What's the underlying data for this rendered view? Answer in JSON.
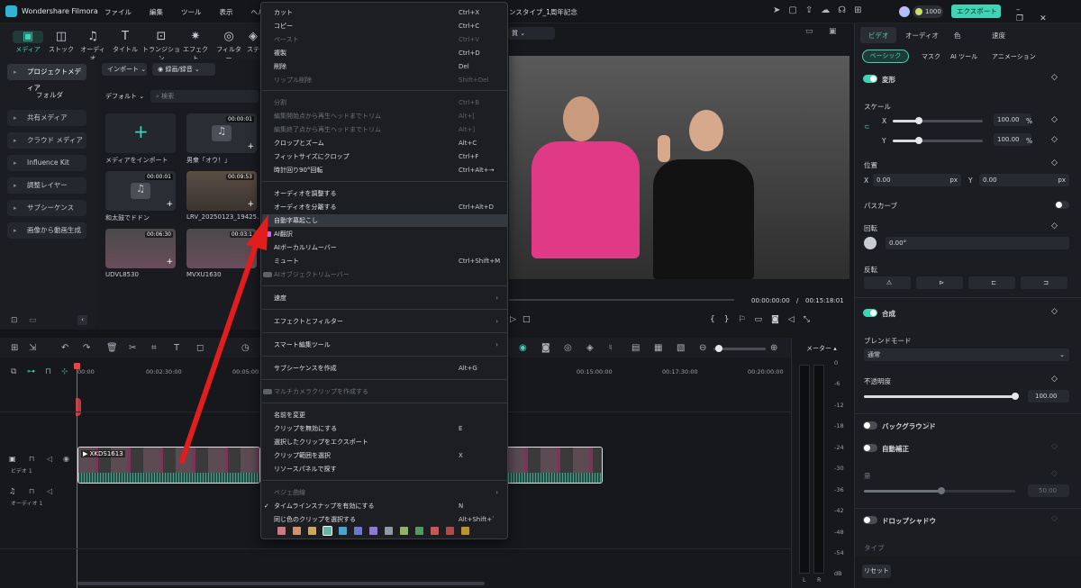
{
  "app": {
    "title": "Wondershare Filmora",
    "doc_title": "ンスタイプ_1周年記念",
    "menu": [
      "ファイル",
      "編集",
      "ツール",
      "表示",
      "ヘルプ"
    ],
    "credits": "1000",
    "export": "エクスポート"
  },
  "toptabs": [
    {
      "label": "メディア",
      "icon": "▣"
    },
    {
      "label": "ストック",
      "icon": "◫"
    },
    {
      "label": "オーディオ",
      "icon": "♫"
    },
    {
      "label": "タイトル",
      "icon": "T"
    },
    {
      "label": "トランジション",
      "icon": "⊡"
    },
    {
      "label": "エフェクト",
      "icon": "✷"
    },
    {
      "label": "フィルター",
      "icon": "◎"
    },
    {
      "label": "ステ",
      "icon": "◈"
    }
  ],
  "sidebar": [
    "プロジェクトメディア",
    "フォルダ",
    "共有メディア",
    "クラウド メディア",
    "Influence Kit",
    "調整レイヤー",
    "サブシーケンス",
    "画像から動画生成"
  ],
  "media": {
    "import": "インポート",
    "record": "録画/録音",
    "sort": "デフォルト",
    "search": "検索",
    "items": [
      {
        "label": "メディアをインポート",
        "dur": ""
      },
      {
        "label": "男衆「オウ！」",
        "dur": "00:00:01"
      },
      {
        "label": "和太鼓でドドン",
        "dur": "00:00:01"
      },
      {
        "label": "LRV_20250123_19425...",
        "dur": "00:09:53"
      },
      {
        "label": "UDVL8530",
        "dur": "00:06:30"
      },
      {
        "label": "MVXU1630",
        "dur": "00:03:1"
      }
    ]
  },
  "context_menu": [
    {
      "label": "カット",
      "sc": "Ctrl+X"
    },
    {
      "label": "コピー",
      "sc": "Ctrl+C"
    },
    {
      "label": "ペースト",
      "sc": "Ctrl+V",
      "dis": true
    },
    {
      "label": "複製",
      "sc": "Ctrl+D"
    },
    {
      "label": "削除",
      "sc": "Del"
    },
    {
      "label": "リップル削除",
      "sc": "Shift+Del",
      "dis": true
    },
    {
      "label": "分割",
      "sc": "Ctrl+B",
      "dis": true
    },
    {
      "label": "編集開始点から再生ヘッドまでトリム",
      "sc": "Alt+[",
      "dis": true
    },
    {
      "label": "編集終了点から再生ヘッドまでトリム",
      "sc": "Alt+]",
      "dis": true
    },
    {
      "label": "クロップとズーム",
      "sc": "Alt+C"
    },
    {
      "label": "フィットサイズにクロップ",
      "sc": "Ctrl+F"
    },
    {
      "label": "時計回り90°回転",
      "sc": "Ctrl+Alt+→"
    },
    {
      "label": "オーディオを調整する",
      "sc": ""
    },
    {
      "label": "オーディオを分離する",
      "sc": "Ctrl+Alt+D"
    },
    {
      "label": "自動字幕起こし",
      "sc": ""
    },
    {
      "label": "AI翻訳",
      "sc": ""
    },
    {
      "label": "AIボーカルリムーバー",
      "sc": ""
    },
    {
      "label": "ミュート",
      "sc": "Ctrl+Shift+M"
    },
    {
      "label": "AIオブジェクトリムーバー",
      "sc": "",
      "dis": true
    },
    {
      "label": "速度",
      "sc": ""
    },
    {
      "label": "エフェクトとフィルター",
      "sc": ""
    },
    {
      "label": "スマート編集ツール",
      "sc": ""
    },
    {
      "label": "サブシーケンスを作成",
      "sc": "Alt+G"
    },
    {
      "label": "マルチカメラクリップを作成する",
      "sc": "",
      "dis": true
    },
    {
      "label": "名前を変更",
      "sc": ""
    },
    {
      "label": "クリップを無効にする",
      "sc": "E"
    },
    {
      "label": "選択したクリップをエクスポート",
      "sc": ""
    },
    {
      "label": "クリップ範囲を選択",
      "sc": "X"
    },
    {
      "label": "リソースパネルで探す",
      "sc": ""
    },
    {
      "label": "ベジェ曲線",
      "sc": "",
      "dis": true
    },
    {
      "label": "タイムラインスナップを有効にする",
      "sc": "N"
    },
    {
      "label": "同じ色のクリップを選択する",
      "sc": "Alt+Shift+`"
    }
  ],
  "swatches": [
    "#c97b84",
    "#d58f6a",
    "#c9a85c",
    "#5fb7a8",
    "#4aa3c9",
    "#6a78d6",
    "#8d7bd3",
    "#8b9aa3",
    "#8fb36a",
    "#4e9c62",
    "#c25a5a",
    "#b1484a",
    "#b8942e"
  ],
  "preview": {
    "time": "00:00:00:00",
    "total": "00:15:18:01"
  },
  "right": {
    "tabs": [
      "ビデオ",
      "オーディオ",
      "色",
      "速度"
    ],
    "sub": [
      "ベーシック",
      "マスク",
      "AI ツール",
      "アニメーション"
    ],
    "transform": "変形",
    "scale": "スケール",
    "x": "X",
    "y": "Y",
    "scale_x": "100.00",
    "scale_y": "100.00",
    "pct": "%",
    "position": "位置",
    "pos_x": "0.00",
    "pos_y": "0.00",
    "px": "px",
    "path": "パスカーブ",
    "rotate": "回転",
    "rotate_val": "0.00°",
    "flip": "反転",
    "composite": "合成",
    "blend": "ブレンドモード",
    "blend_val": "通常",
    "opacity": "不透明度",
    "opacity_val": "100.00",
    "bg": "バックグラウンド",
    "auto": "自動補正",
    "amount": "量",
    "amount_val": "50.00",
    "shadow": "ドロップシャドウ",
    "type": "タイプ",
    "reset": "リセット"
  },
  "timeline": {
    "ticks": [
      "00:00",
      "00:02:30:00",
      "00:05:00",
      "00:15:00:00",
      "00:17:30:00",
      "00:20:00:00"
    ],
    "clip": "XKDS1613",
    "video": "ビデオ 1",
    "audio": "オーディオ 1"
  },
  "meter": {
    "label": "メーター",
    "ticks": [
      "0",
      "-6",
      "-12",
      "-18",
      "-24",
      "-30",
      "-36",
      "-42",
      "-48",
      "-54",
      "dB"
    ],
    "l": "L",
    "r": "R"
  }
}
